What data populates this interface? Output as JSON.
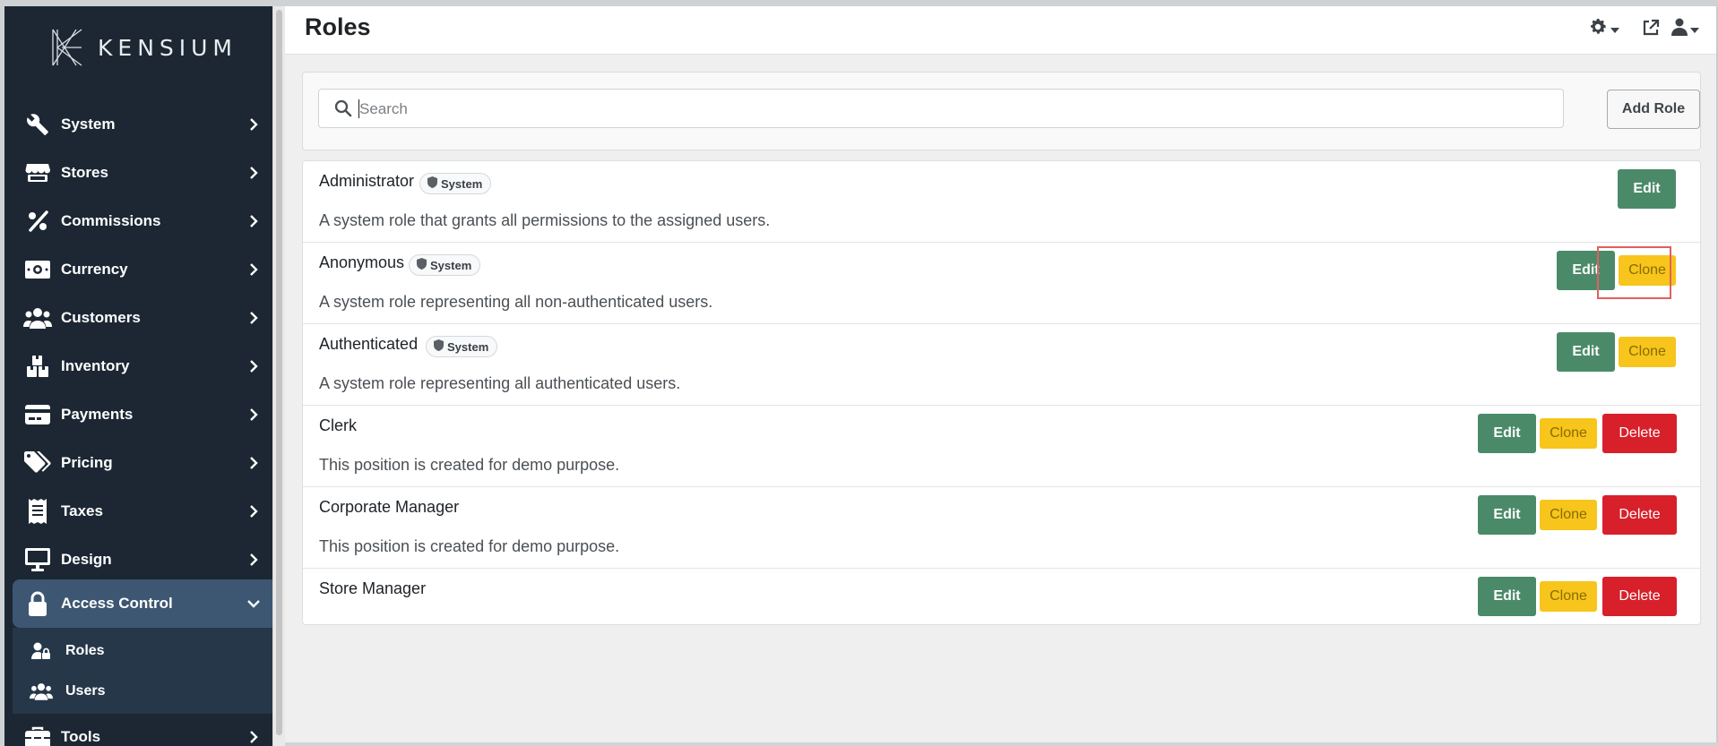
{
  "app": {
    "brand": "KENSIUM"
  },
  "sidebar": {
    "items": [
      {
        "label": "System",
        "icon": "wrench-icon"
      },
      {
        "label": "Stores",
        "icon": "store-icon"
      },
      {
        "label": "Commissions",
        "icon": "percent-icon"
      },
      {
        "label": "Currency",
        "icon": "money-bill-icon"
      },
      {
        "label": "Customers",
        "icon": "users-icon"
      },
      {
        "label": "Inventory",
        "icon": "boxes-icon"
      },
      {
        "label": "Payments",
        "icon": "credit-card-icon"
      },
      {
        "label": "Pricing",
        "icon": "tags-icon"
      },
      {
        "label": "Taxes",
        "icon": "receipt-icon"
      },
      {
        "label": "Design",
        "icon": "monitor-icon"
      },
      {
        "label": "Access Control",
        "icon": "lock-icon",
        "expanded": true
      },
      {
        "label": "Tools",
        "icon": "toolbox-icon"
      }
    ],
    "submenu": [
      {
        "label": "Roles",
        "icon": "user-lock-icon",
        "active": true
      },
      {
        "label": "Users",
        "icon": "users-icon"
      }
    ]
  },
  "header": {
    "title": "Roles"
  },
  "search": {
    "placeholder": "Search",
    "value": ""
  },
  "toolbar": {
    "add_role_label": "Add Role"
  },
  "roles": [
    {
      "name": "Administrator",
      "badge": "System",
      "description": "A system role that grants all permissions to the assigned users.",
      "actions": [
        "Edit"
      ]
    },
    {
      "name": "Anonymous",
      "badge": "System",
      "description": "A system role representing all non-authenticated users.",
      "actions": [
        "Edit",
        "Clone"
      ]
    },
    {
      "name": "Authenticated",
      "badge": "System",
      "description": "A system role representing all authenticated users.",
      "actions": [
        "Edit",
        "Clone"
      ]
    },
    {
      "name": "Clerk",
      "badge": "",
      "description": "This position is created for demo purpose.",
      "actions": [
        "Edit",
        "Clone",
        "Delete"
      ]
    },
    {
      "name": "Corporate Manager",
      "badge": "",
      "description": "This position is created for demo purpose.",
      "actions": [
        "Edit",
        "Clone",
        "Delete"
      ]
    },
    {
      "name": "Store Manager",
      "badge": "",
      "description": "",
      "actions": [
        "Edit",
        "Clone",
        "Delete"
      ]
    }
  ],
  "labels": {
    "edit": "Edit",
    "clone": "Clone",
    "delete": "Delete"
  },
  "colors": {
    "sidebar_bg": "#1c2733",
    "sidebar_active": "#3d5772",
    "edit_button": "#4b8a69",
    "clone_button": "#f7c51b",
    "delete_button": "#d7202a",
    "highlight": "#e06060"
  }
}
